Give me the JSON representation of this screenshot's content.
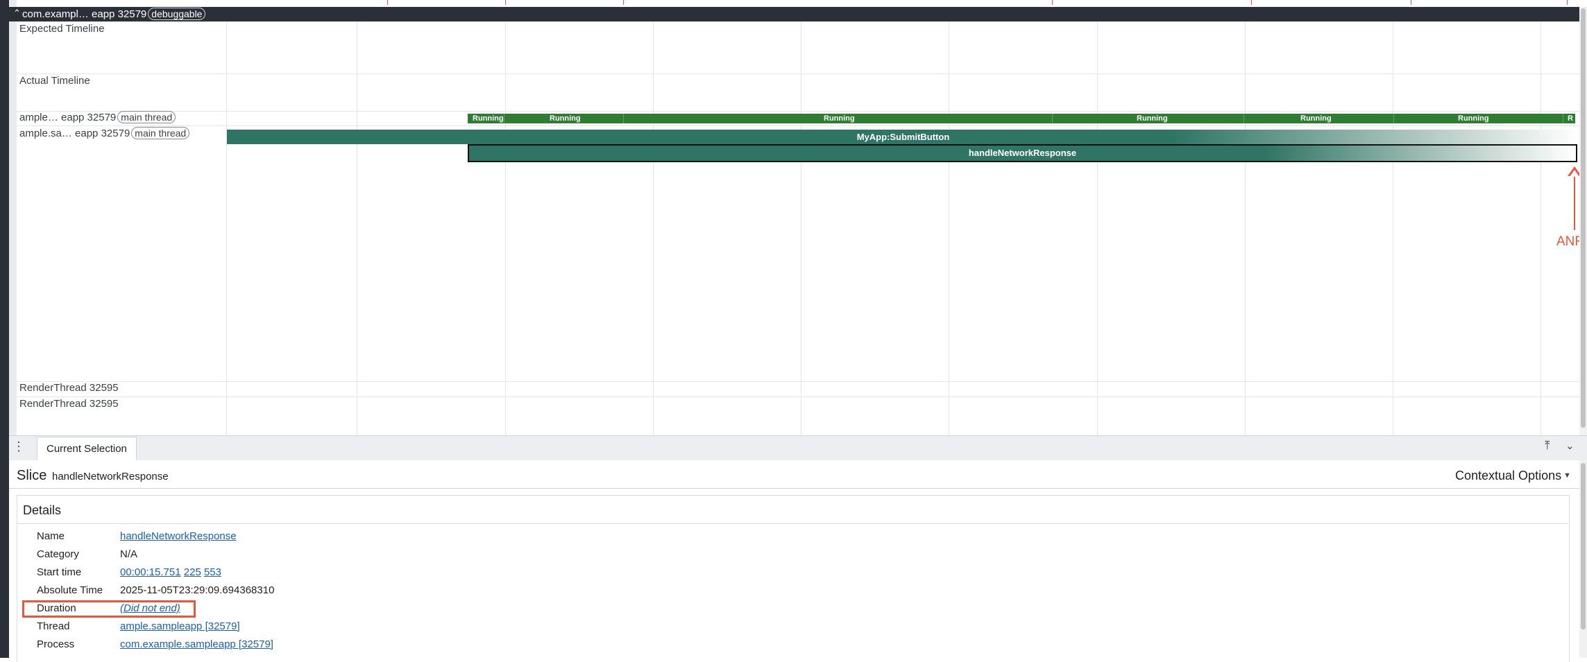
{
  "process": {
    "name": "com.exampl… eapp 32579",
    "badge": "debuggable"
  },
  "tracks": {
    "expected": "Expected Timeline",
    "actual": "Actual Timeline",
    "thread1_name": "ample… eapp 32579",
    "thread1_badge": "main thread",
    "thread2_name": "ample.sa… eapp 32579",
    "thread2_badge": "main thread",
    "render1": "RenderThread 32595",
    "render2": "RenderThread 32595"
  },
  "running_labels": [
    "Running",
    "Running",
    "Running",
    "Running",
    "Running",
    "Running",
    "R"
  ],
  "slices": {
    "submit": "MyApp:SubmitButton",
    "handle": "handleNetworkResponse"
  },
  "annotation": {
    "anr": "ANR"
  },
  "panel": {
    "tab": "Current Selection",
    "heading": "Slice",
    "heading_name": "handleNetworkResponse",
    "contextual": "Contextual Options",
    "details_title": "Details",
    "rows": [
      {
        "label": "Name",
        "value": "handleNetworkResponse"
      },
      {
        "label": "Category",
        "value": "N/A"
      },
      {
        "label": "Start time",
        "value_a": "00:00:15.751",
        "value_b": "225",
        "value_c": "553"
      },
      {
        "label": "Absolute Time",
        "value": "2025-11-05T23:29:09.694368310"
      },
      {
        "label": "Duration",
        "value": "(Did not end)"
      },
      {
        "label": "Thread",
        "value": "ample.sampleapp [32579]"
      },
      {
        "label": "Process",
        "value": "com.example.sampleapp [32579]"
      }
    ]
  },
  "icons": {
    "menu": "vertical-dots-icon",
    "pin": "pin-top-icon",
    "collapse": "chevron-down-icon",
    "context_caret": "caret-down-icon",
    "chevron": "chevron-up-icon"
  },
  "colors": {
    "running": "#2e7d32",
    "slice": "#2f7565",
    "anr": "#e8573a",
    "link": "#1a5fb4"
  }
}
